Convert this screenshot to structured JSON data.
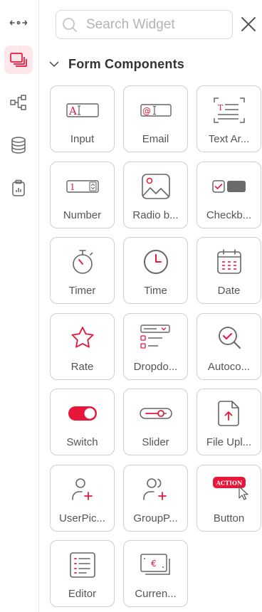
{
  "colors": {
    "accent": "#e8173a",
    "icon": "#6b6b6b",
    "active_bg": "#fde7ea"
  },
  "rail": {
    "items": [
      {
        "name": "expand-collapse",
        "icon": "arrows-expand-icon"
      },
      {
        "name": "widgets",
        "icon": "layers-icon",
        "active": true
      },
      {
        "name": "tree",
        "icon": "hierarchy-icon"
      },
      {
        "name": "database",
        "icon": "database-icon"
      },
      {
        "name": "clipboard",
        "icon": "clipboard-icon"
      }
    ]
  },
  "search": {
    "placeholder": "Search Widget",
    "value": ""
  },
  "section": {
    "title": "Form Components",
    "expanded": true
  },
  "widgets": [
    {
      "label": "Input",
      "icon": "input-icon"
    },
    {
      "label": "Email",
      "icon": "email-field-icon"
    },
    {
      "label": "Text Ar...",
      "icon": "textarea-icon"
    },
    {
      "label": "Number",
      "icon": "number-stepper-icon"
    },
    {
      "label": "Radio b...",
      "icon": "image-icon"
    },
    {
      "label": "Checkb...",
      "icon": "checkbox-icon"
    },
    {
      "label": "Timer",
      "icon": "stopwatch-icon"
    },
    {
      "label": "Time",
      "icon": "clock-icon"
    },
    {
      "label": "Date",
      "icon": "calendar-icon"
    },
    {
      "label": "Rate",
      "icon": "star-icon"
    },
    {
      "label": "Dropdo...",
      "icon": "dropdown-icon"
    },
    {
      "label": "Autoco...",
      "icon": "search-check-icon"
    },
    {
      "label": "Switch",
      "icon": "toggle-switch-icon"
    },
    {
      "label": "Slider",
      "icon": "slider-icon"
    },
    {
      "label": "File Upl...",
      "icon": "file-upload-icon"
    },
    {
      "label": "UserPic...",
      "icon": "user-add-icon"
    },
    {
      "label": "GroupP...",
      "icon": "group-add-icon"
    },
    {
      "label": "Button",
      "icon": "action-button-icon",
      "badge": "ACTION"
    },
    {
      "label": "Editor",
      "icon": "editor-list-icon"
    },
    {
      "label": "Curren...",
      "icon": "currency-icon",
      "symbol": "€"
    }
  ]
}
